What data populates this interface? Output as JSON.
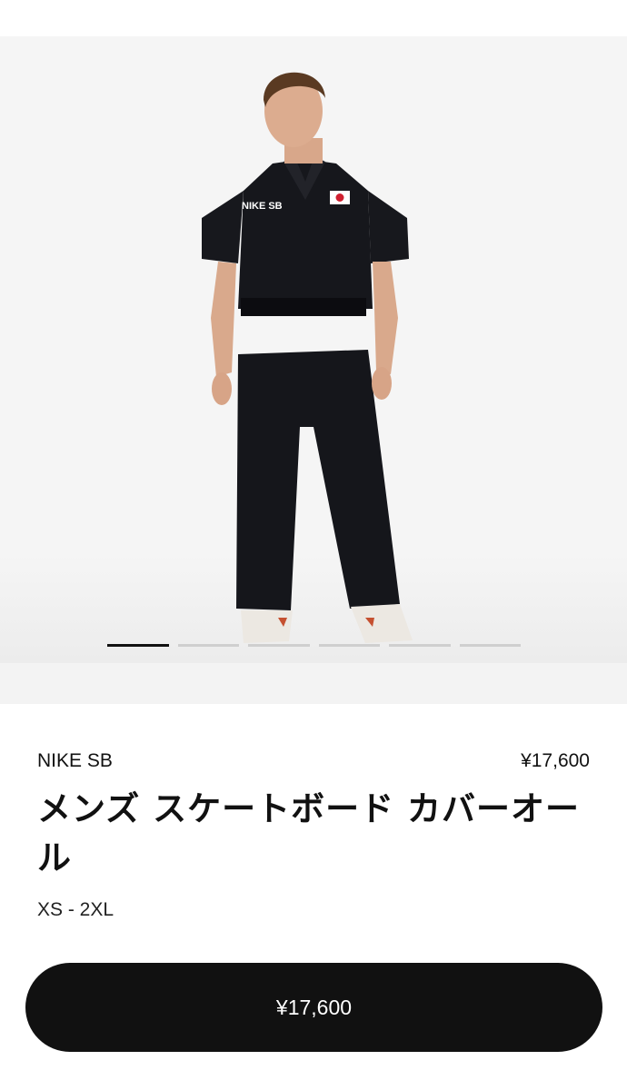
{
  "gallery": {
    "slide_count": 6,
    "active_slide": 1
  },
  "product": {
    "brand": "NIKE SB",
    "price": "¥17,600",
    "title": "メンズ スケートボード カバーオール",
    "sizes": "XS - 2XL"
  },
  "buy_button": {
    "label": "¥17,600"
  },
  "colors": {
    "primary": "#111111",
    "background": "#ffffff",
    "gallery_bg": "#f5f5f5"
  }
}
